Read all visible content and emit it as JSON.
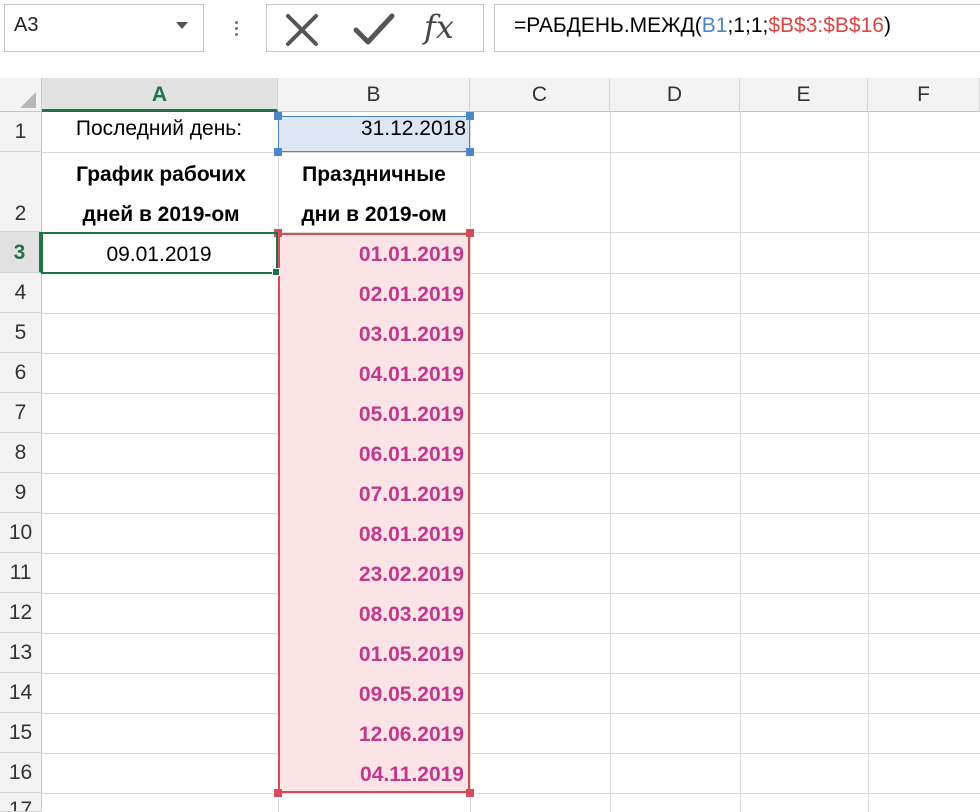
{
  "formula_bar": {
    "name_box": "A3",
    "formula_prefix": "=РАБДЕНЬ.МЕЖД(",
    "formula_ref1": "B1",
    "formula_mid": ";1;1;",
    "formula_ref2": "$B$3:$B$16",
    "formula_suffix": ")",
    "fx_label": "fx"
  },
  "columns": [
    "A",
    "B",
    "C",
    "D",
    "E",
    "F"
  ],
  "rows": [
    "1",
    "2",
    "3",
    "4",
    "5",
    "6",
    "7",
    "8",
    "9",
    "10",
    "11",
    "12",
    "13",
    "14",
    "15",
    "16",
    "17"
  ],
  "cells": {
    "A1": "Последний день:",
    "B1": "31.12.2018",
    "A2_line1": "График рабочих",
    "A2_line2": "дней в 2019-ом",
    "B2_line1": "Праздничные",
    "B2_line2": "дни в 2019-ом",
    "A3": "09.01.2019"
  },
  "holidays": [
    "01.01.2019",
    "02.01.2019",
    "03.01.2019",
    "04.01.2019",
    "05.01.2019",
    "06.01.2019",
    "07.01.2019",
    "08.01.2019",
    "23.02.2019",
    "08.03.2019",
    "01.05.2019",
    "09.05.2019",
    "12.06.2019",
    "04.11.2019"
  ],
  "colors": {
    "selection": "#217346",
    "ref_blue": "#4a86c8",
    "ref_red": "#d44d5a",
    "holiday_text": "#c0398c"
  }
}
